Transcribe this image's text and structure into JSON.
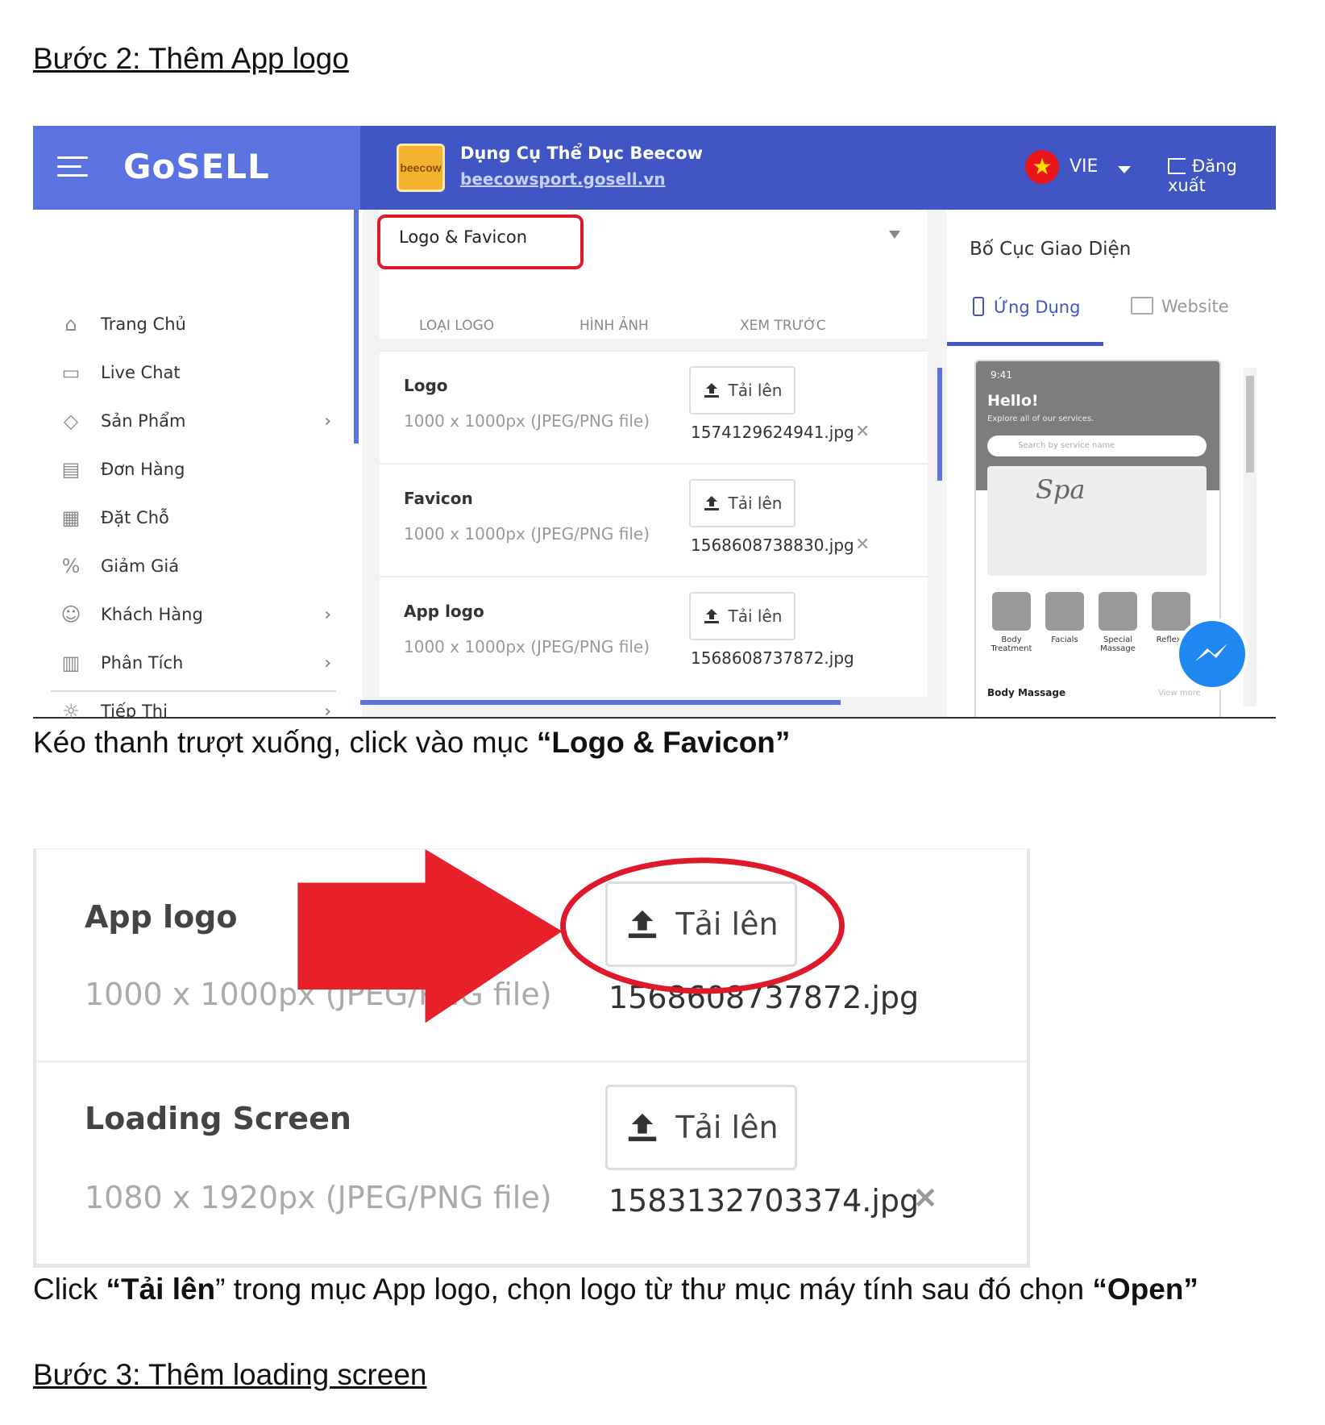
{
  "doc": {
    "heading_step2": "Bước 2: Thêm App logo ",
    "caption1_prefix": "Kéo thanh trượt xuống, click vào mục  ",
    "caption1_bold": "“Logo & Favicon”",
    "caption2_a": "Click ",
    "caption2_b": "“Tải lên",
    "caption2_c": "” trong mục App logo, chọn logo từ thư mục máy tính sau đó chọn ",
    "caption2_d": "“Open”",
    "heading_step3": "Bước 3: Thêm loading screen"
  },
  "app": {
    "brand": "GoSELL",
    "store_name": "Dụng Cụ Thể Dục Beecow",
    "store_url": "beecowsport.gosell.vn",
    "store_logo_text": "beecow",
    "language": "VIE",
    "logout_label": "Đăng xuất",
    "accent_color": "#3f56c4"
  },
  "sidebar": {
    "items": [
      {
        "label": "Trang Chủ",
        "icon": "home-icon",
        "chevron": false
      },
      {
        "label": "Live Chat",
        "icon": "chat-icon",
        "chevron": false
      },
      {
        "label": "Sản Phẩm",
        "icon": "tag-icon",
        "chevron": true
      },
      {
        "label": "Đơn Hàng",
        "icon": "receipt-icon",
        "chevron": false
      },
      {
        "label": "Đặt Chỗ",
        "icon": "calendar-icon",
        "chevron": false
      },
      {
        "label": "Giảm Giá",
        "icon": "discount-icon",
        "chevron": false
      },
      {
        "label": "Khách Hàng",
        "icon": "users-icon",
        "chevron": true
      },
      {
        "label": "Phân Tích",
        "icon": "chart-icon",
        "chevron": true
      },
      {
        "label": "Tiếp Thị",
        "icon": "bulb-icon",
        "chevron": true
      }
    ]
  },
  "section": {
    "title": "Logo & Favicon",
    "columns": [
      "LOẠI LOGO",
      "HÌNH ẢNH",
      "XEM TRƯỚC"
    ],
    "upload_label": "Tải lên",
    "rows": [
      {
        "name": "Logo",
        "spec": "1000 x 1000px (JPEG/PNG file)",
        "file": "1574129624941.jpg",
        "remove": "✕"
      },
      {
        "name": "Favicon",
        "spec": "1000 x 1000px (JPEG/PNG file)",
        "file": "1568608738830.jpg",
        "remove": "✕"
      },
      {
        "name": "App logo",
        "spec": "1000 x 1000px (JPEG/PNG file)",
        "file": "1568608737872.jpg",
        "remove": ""
      }
    ]
  },
  "preview": {
    "title": "Bố Cục Giao Diện",
    "tab_app": "Ứng Dụng",
    "tab_web": "Website",
    "phone": {
      "time": "9:41",
      "hello": "Hello!",
      "subtitle": "Explore all of our services.",
      "search_placeholder": "Search by service name",
      "banner_text": "Spa",
      "categories": [
        "Body Treatment",
        "Facials",
        "Special Massage",
        "Reflexo"
      ],
      "section_title": "Body Massage",
      "more": "View more"
    }
  },
  "zoom": {
    "upload_label": "Tải lên",
    "rows": [
      {
        "name": "App logo",
        "spec": "1000 x 1000px (JPEG/PNG file)",
        "file": "1568608737872.jpg",
        "remove": ""
      },
      {
        "name": "Loading Screen",
        "spec": "1080 x 1920px (JPEG/PNG file)",
        "file": "1583132703374.jpg",
        "remove": "✕"
      }
    ]
  }
}
